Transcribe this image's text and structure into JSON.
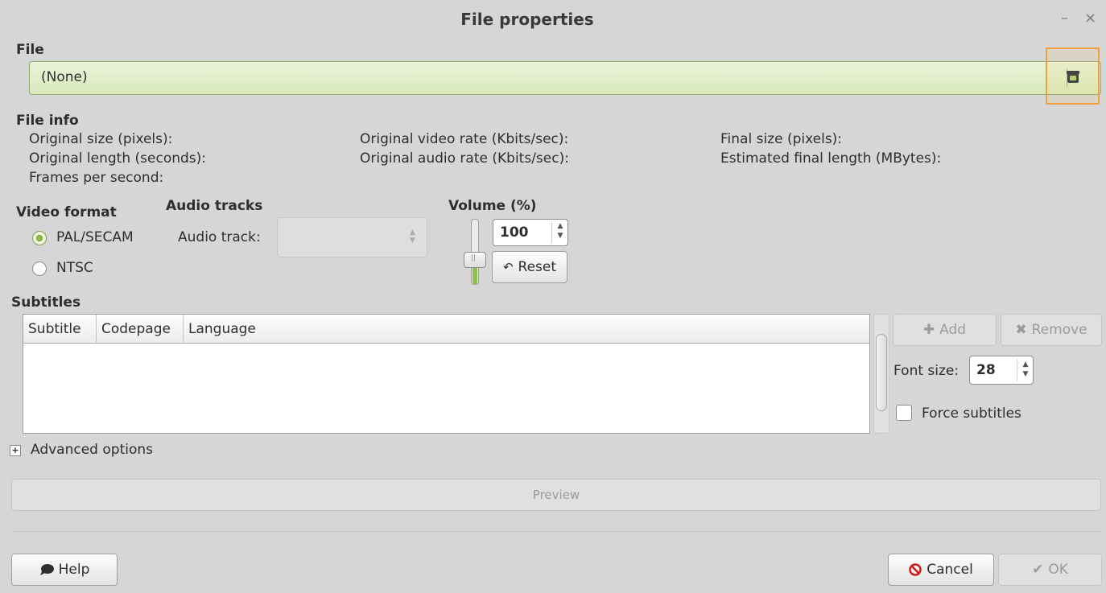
{
  "window": {
    "title": "File properties",
    "minimize_glyph": "–",
    "close_glyph": "×"
  },
  "file": {
    "section_label": "File",
    "value": "(None)",
    "browse_icon": "folder-open-icon"
  },
  "file_info": {
    "section_label": "File info",
    "col1": [
      "Original size (pixels):",
      "Original length (seconds):",
      "Frames per second:"
    ],
    "col2": [
      "Original video rate (Kbits/sec):",
      "Original audio rate (Kbits/sec):"
    ],
    "col3": [
      "Final size (pixels):",
      "Estimated final length (MBytes):"
    ]
  },
  "video_format": {
    "section_label": "Video format",
    "options": [
      "PAL/SECAM",
      "NTSC"
    ],
    "selected": "PAL/SECAM"
  },
  "audio_tracks": {
    "section_label": "Audio tracks",
    "track_label": "Audio track:",
    "track_value": ""
  },
  "volume": {
    "section_label": "Volume (%)",
    "value": "100",
    "level_fraction": 0.45,
    "reset_label": "Reset",
    "reset_icon": "undo-icon"
  },
  "subtitles": {
    "section_label": "Subtitles",
    "columns": [
      "Subtitle",
      "Codepage",
      "Language"
    ],
    "rows": [],
    "add_label": "Add",
    "remove_label": "Remove",
    "font_size_label": "Font size:",
    "font_size_value": "28",
    "force_label": "Force subtitles",
    "force_checked": false
  },
  "advanced": {
    "label": "Advanced options",
    "expander_glyph": "+"
  },
  "preview": {
    "label": "Preview"
  },
  "footer": {
    "help_label": "Help",
    "cancel_label": "Cancel",
    "ok_label": "OK"
  },
  "colors": {
    "accent_green": "#8fbf4a",
    "highlight_orange": "#f0a040",
    "cancel_red": "#d01818"
  }
}
